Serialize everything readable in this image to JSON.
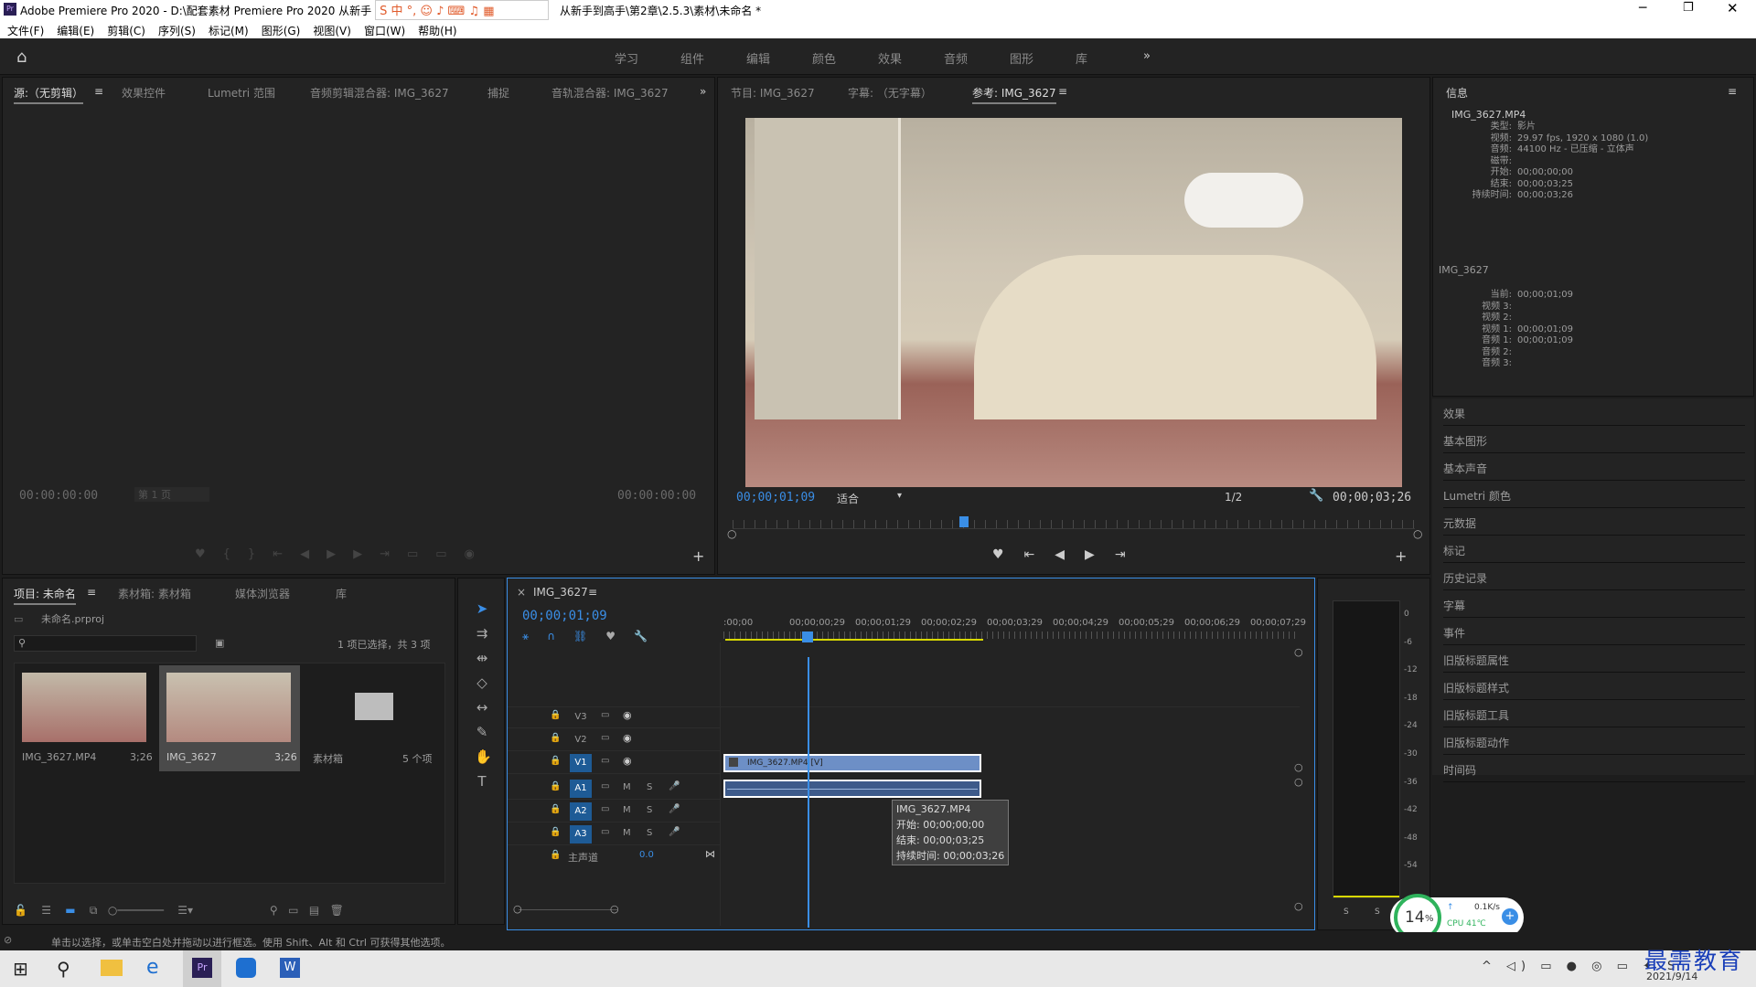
{
  "app": {
    "title": "Adobe Premiere Pro 2020 - D:\\配套素材 Premiere Pro 2020 从新手到高手\\第2章\\2.5.3\\素材\\未命名 *",
    "title_left": "Adobe Premiere Pro 2020 - D:\\配套素材 Premiere Pro 2020 从新手",
    "title_right": "从新手到高手\\第2章\\2.5.3\\素材\\未命名 *"
  },
  "menu": [
    "文件(F)",
    "编辑(E)",
    "剪辑(C)",
    "序列(S)",
    "标记(M)",
    "图形(G)",
    "视图(V)",
    "窗口(W)",
    "帮助(H)"
  ],
  "workspaces": [
    "学习",
    "组件",
    "编辑",
    "颜色",
    "效果",
    "音频",
    "图形",
    "库"
  ],
  "source_panel": {
    "tabs": [
      "源:（无剪辑）",
      "效果控件",
      "Lumetri 范围",
      "音频剪辑混合器: IMG_3627",
      "捕捉",
      "音轨混合器: IMG_3627"
    ],
    "tc_in": "00:00:00:00",
    "tc_out": "00:00:00:00",
    "page": "第 1 页"
  },
  "program_panel": {
    "tabs": [
      "节目: IMG_3627",
      "字幕: （无字幕）",
      "参考: IMG_3627"
    ],
    "timecode": "00;00;01;09",
    "fit": "适合",
    "ratio": "1/2",
    "duration": "00;00;03;26"
  },
  "info_panel": {
    "title": "信息",
    "file": "IMG_3627.MP4",
    "rows": [
      [
        "类型:",
        "影片"
      ],
      [
        "视频:",
        "29.97 fps, 1920 x 1080 (1.0)"
      ],
      [
        "音频:",
        "44100 Hz - 已压缩 - 立体声"
      ],
      [
        "磁带:",
        ""
      ],
      [
        "开始:",
        "00;00;00;00"
      ],
      [
        "结束:",
        "00;00;03;25"
      ],
      [
        "持续时间:",
        "00;00;03;26"
      ]
    ],
    "seq": "IMG_3627",
    "seq_rows": [
      [
        "当前:",
        "00;00;01;09"
      ],
      [
        "视频 3:",
        ""
      ],
      [
        "视频 2:",
        ""
      ],
      [
        "视频 1:",
        "00;00;01;09"
      ],
      [
        "音频 1:",
        "00;00;01;09"
      ],
      [
        "音频 2:",
        ""
      ],
      [
        "音频 3:",
        ""
      ]
    ]
  },
  "right_list": [
    "效果",
    "基本图形",
    "基本声音",
    "Lumetri 颜色",
    "元数据",
    "标记",
    "历史记录",
    "字幕",
    "事件",
    "旧版标题属性",
    "旧版标题样式",
    "旧版标题工具",
    "旧版标题动作",
    "时间码"
  ],
  "project_panel": {
    "tabs": [
      "项目: 未命名",
      "素材箱: 素材箱",
      "媒体浏览器",
      "库"
    ],
    "file": "未命名.prproj",
    "status": "1 项已选择，共 3 项",
    "items": [
      {
        "name": "IMG_3627.MP4",
        "dur": "3;26"
      },
      {
        "name": "IMG_3627",
        "dur": "3;26"
      },
      {
        "name": "素材箱",
        "dur": "5 个项"
      }
    ]
  },
  "timeline": {
    "tab": "IMG_3627",
    "timecode": "00;00;01;09",
    "ruler": [
      ":00;00",
      "00;00;00;29",
      "00;00;01;29",
      "00;00;02;29",
      "00;00;03;29",
      "00;00;04;29",
      "00;00;05;29",
      "00;00;06;29",
      "00;00;07;29"
    ],
    "video_tracks": [
      "V3",
      "V2",
      "V1"
    ],
    "audio_tracks": [
      "A1",
      "A2",
      "A3"
    ],
    "master": "主声道",
    "master_val": "0.0",
    "clip_label": "IMG_3627.MP4 [V]",
    "tooltip": [
      "IMG_3627.MP4",
      "开始: 00;00;00;00",
      "结束: 00;00;03;25",
      "持续时间: 00;00;03;26"
    ]
  },
  "meter": {
    "scale": [
      "0",
      "-6",
      "-12",
      "-18",
      "-24",
      "-30",
      "-36",
      "-42",
      "-48",
      "-54"
    ],
    "s": "S"
  },
  "status_bar": "单击以选择，或单击空白处并拖动以进行框选。使用 Shift、Alt 和 Ctrl 可获得其他选项。",
  "perf": {
    "cpu_pct": "14",
    "cpu_unit": "%",
    "net": "0.1K/s",
    "cpu_temp": "CPU 41℃"
  },
  "taskbar": {
    "date": "2021/9/14"
  },
  "watermark": "最需教育",
  "colors": {
    "accent": "#3a8ee6",
    "clip_video": "#6d8fc6",
    "clip_audio": "#3d5a8a",
    "tracklabel": "#1e5b96"
  }
}
